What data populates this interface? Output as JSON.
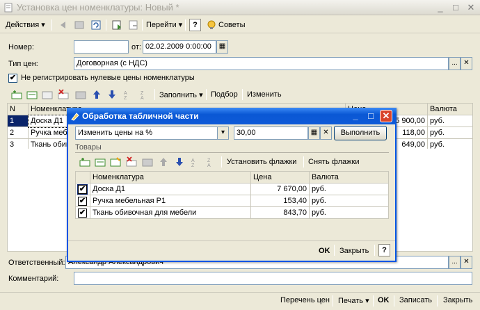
{
  "window": {
    "title": "Установка цен номенклатуры: Новый *"
  },
  "toolbar": {
    "actions": "Действия",
    "goto": "Перейти",
    "help": "?",
    "tips": "Советы"
  },
  "form": {
    "number_label": "Номер:",
    "number_value": "",
    "date_label": "от:",
    "date_value": "02.02.2009  0:00:00",
    "price_type_label": "Тип цен:",
    "price_type_value": "Договорная (с НДС)",
    "checkbox_label": "Не регистрировать нулевые цены номенклатуры",
    "fill_button": "Заполнить",
    "pick_button": "Подбор",
    "change_button": "Изменить",
    "responsible_label": "Ответственный:",
    "responsible_value": "Александр Александрович",
    "comment_label": "Комментарий:",
    "comment_value": ""
  },
  "main_table": {
    "headers": [
      "N",
      "Номенклатура",
      "Цена",
      "Валюта"
    ],
    "rows": [
      {
        "n": "1",
        "name": "Доска Д1",
        "price": "5 900,00",
        "currency": "руб."
      },
      {
        "n": "2",
        "name": "Ручка мебе",
        "price": "118,00",
        "currency": "руб."
      },
      {
        "n": "3",
        "name": "Ткань обив",
        "price": "649,00",
        "currency": "руб."
      }
    ]
  },
  "status": {
    "price_list": "Перечень цен",
    "print": "Печать",
    "ok": "OK",
    "save": "Записать",
    "close": "Закрыть"
  },
  "dialog": {
    "title": "Обработка табличной части",
    "action_select": "Изменить цены на %",
    "percent_value": "30,00",
    "execute_button": "Выполнить",
    "goods_label": "Товары",
    "set_flags": "Установить флажки",
    "clear_flags": "Снять флажки",
    "headers": [
      "Номенклатура",
      "Цена",
      "Валюта"
    ],
    "rows": [
      {
        "name": "Доска Д1",
        "price": "7 670,00",
        "currency": "руб."
      },
      {
        "name": "Ручка мебельная Р1",
        "price": "153,40",
        "currency": "руб."
      },
      {
        "name": "Ткань обивочная для мебели",
        "price": "843,70",
        "currency": "руб."
      }
    ],
    "ok": "OK",
    "close": "Закрыть",
    "help": "?"
  }
}
